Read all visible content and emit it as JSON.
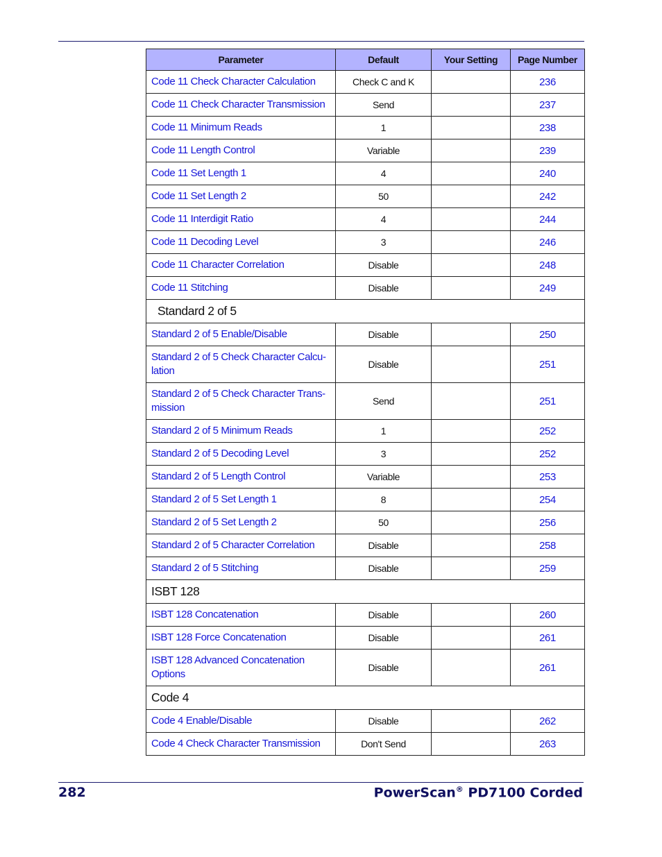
{
  "header": {
    "parameter": "Parameter",
    "default": "Default",
    "your_setting": "Your Setting",
    "page_number": "Page Number"
  },
  "rows": [
    {
      "param": "Code 11 Check Character Calculation",
      "default": "Check C and K",
      "page": "236"
    },
    {
      "param": "Code 11 Check Character Transmission",
      "default": "Send",
      "page": "237"
    },
    {
      "param": "Code 11 Minimum Reads",
      "default": "1",
      "page": "238"
    },
    {
      "param": "Code 11 Length Control",
      "default": "Variable",
      "page": "239"
    },
    {
      "param": "Code 11 Set Length 1",
      "default": "4",
      "page": "240"
    },
    {
      "param": "Code 11 Set Length 2",
      "default": "50",
      "page": "242"
    },
    {
      "param": "Code 11 Interdigit Ratio",
      "default": "4",
      "page": "244"
    },
    {
      "param": "Code 11 Decoding Level",
      "default": "3",
      "page": "246"
    },
    {
      "param": "Code 11 Character Correlation",
      "default": "Disable",
      "page": "248"
    },
    {
      "param": "Code 11 Stitching",
      "default": "Disable",
      "page": "249"
    },
    {
      "section": "Standard 2 of 5",
      "indent": true
    },
    {
      "param": "Standard 2 of 5 Enable/Disable",
      "default": "Disable",
      "page": "250"
    },
    {
      "param": "Standard 2 of 5 Check Character Calcu-\nlation",
      "default": "Disable",
      "page": "251"
    },
    {
      "param": "Standard 2 of 5 Check Character Trans-\nmission",
      "default": "Send",
      "page": "251"
    },
    {
      "param": "Standard 2 of 5 Minimum Reads",
      "default": "1",
      "page": "252"
    },
    {
      "param": "Standard 2 of 5 Decoding Level",
      "default": "3",
      "page": "252"
    },
    {
      "param": "Standard 2 of 5 Length Control",
      "default": "Variable",
      "page": "253"
    },
    {
      "param": "Standard 2 of 5 Set Length 1",
      "default": "8",
      "page": "254"
    },
    {
      "param": "Standard 2 of 5 Set Length 2",
      "default": "50",
      "page": "256"
    },
    {
      "param": "Standard 2 of 5 Character Correlation",
      "default": "Disable",
      "page": "258"
    },
    {
      "param": "Standard 2 of 5 Stitching",
      "default": "Disable",
      "page": "259"
    },
    {
      "section": "ISBT 128"
    },
    {
      "param": "ISBT 128 Concatenation",
      "default": "Disable",
      "page": "260"
    },
    {
      "param": "ISBT 128 Force Concatenation",
      "default": "Disable",
      "page": "261"
    },
    {
      "param": "ISBT 128 Advanced Concatenation\nOptions",
      "default": "Disable",
      "page": "261"
    },
    {
      "section": "Code 4"
    },
    {
      "param": "Code 4 Enable/Disable",
      "default": "Disable",
      "page": "262"
    },
    {
      "param": "Code 4 Check Character Transmission",
      "default": "Don't Send",
      "page": "263"
    }
  ],
  "footer": {
    "page": "282",
    "title": "PowerScan",
    "reg": "®",
    "model": " PD7100 Corded"
  }
}
